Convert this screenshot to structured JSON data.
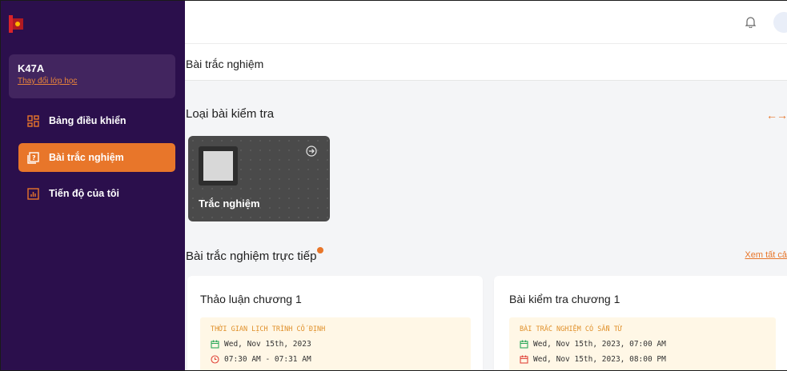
{
  "sidebar": {
    "class_name": "K47A",
    "change_class": "Thay đổi lớp học",
    "items": [
      {
        "label": "Bảng điều khiển",
        "icon": "dashboard-icon",
        "active": false
      },
      {
        "label": "Bài trắc nghiệm",
        "icon": "quiz-icon",
        "active": true
      },
      {
        "label": "Tiến độ của tôi",
        "icon": "chart-icon",
        "active": false
      }
    ]
  },
  "page": {
    "title": "Bài trắc nghiệm"
  },
  "types": {
    "title": "Loại bài kiểm tra",
    "nav": "←→",
    "card_label": "Trắc nghiệm"
  },
  "live": {
    "title": "Bài trắc nghiệm trực tiếp",
    "see_all": "Xem tất cả"
  },
  "quizzes": [
    {
      "title": "Thảo luận chương 1",
      "heading": "THỜI GIAN LỊCH TRÌNH CỐ ĐỊNH",
      "line1": "Wed, Nov 15th, 2023",
      "line2": "07:30 AM - 07:31 AM"
    },
    {
      "title": "Bài kiểm tra chương 1",
      "heading": "BÀI TRẮC NGHIỆM CÓ SẴN TỪ",
      "line1": "Wed, Nov 15th, 2023, 07:00 AM",
      "line2": "Wed, Nov 15th, 2023, 08:00 PM"
    }
  ],
  "colors": {
    "sidebar": "#2b0f4c",
    "accent": "#e8762a",
    "highlight": "#fff7e6"
  }
}
